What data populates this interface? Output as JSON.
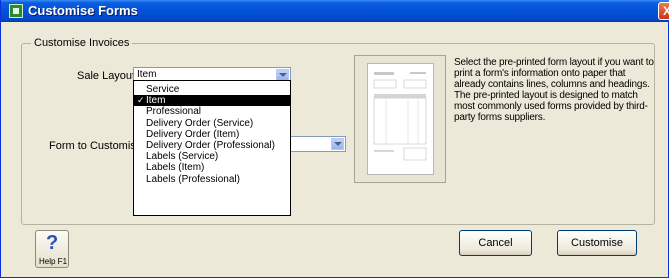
{
  "window": {
    "title": "Customise Forms",
    "close_glyph": "X"
  },
  "group": {
    "label": "Customise Invoices"
  },
  "sale_layout": {
    "label": "Sale Layout:",
    "value": "Item",
    "options": [
      {
        "label": "Service",
        "selected": false
      },
      {
        "label": "Item",
        "selected": true
      },
      {
        "label": "Professional",
        "selected": false
      },
      {
        "label": "Delivery Order (Service)",
        "selected": false
      },
      {
        "label": "Delivery Order (Item)",
        "selected": false
      },
      {
        "label": "Delivery Order (Professional)",
        "selected": false
      },
      {
        "label": "Labels (Service)",
        "selected": false
      },
      {
        "label": "Labels (Item)",
        "selected": false
      },
      {
        "label": "Labels (Professional)",
        "selected": false
      }
    ]
  },
  "form_to_customise": {
    "label": "Form to Customise:",
    "value": ""
  },
  "description": "Select the pre-printed form layout if you want to print a form's information onto paper that already contains lines, columns and headings. The pre-printed layout is designed to match most commonly used forms provided by third-party forms suppliers.",
  "buttons": {
    "help": "Help F1",
    "cancel": "Cancel",
    "customise": "Customise"
  },
  "colors": {
    "titlebar": "#0352d6",
    "selection": "#000000",
    "window_bg": "#ece9d8"
  }
}
